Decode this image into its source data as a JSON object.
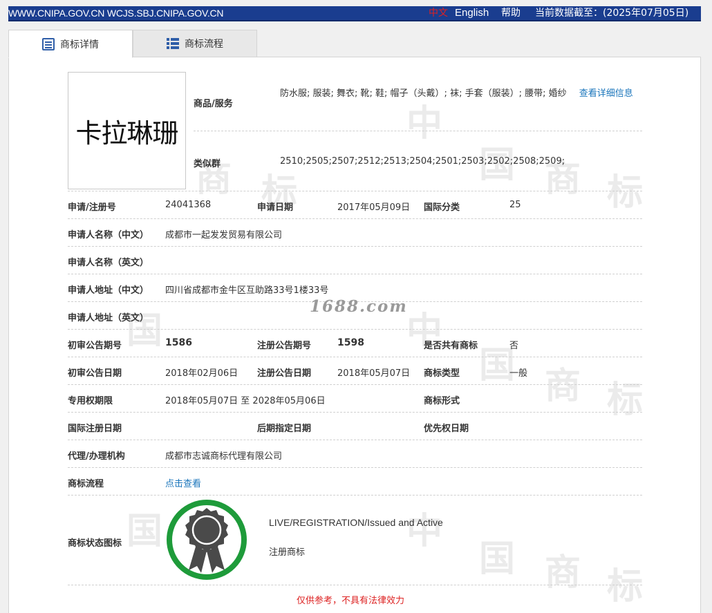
{
  "topbar": {
    "site": "WWW.CNIPA.GOV.CN WCJS.SBJ.CNIPA.GOV.CN",
    "lang_cn": "中文",
    "lang_en": "English",
    "help": "帮助",
    "as_of": "当前数据截至：(2025年07月05日)"
  },
  "tabs": [
    {
      "label": "商标详情",
      "icon": "detail-icon",
      "active": true
    },
    {
      "label": "商标流程",
      "icon": "list-icon",
      "active": false
    }
  ],
  "mark": {
    "image_text": "卡拉琳珊"
  },
  "goods": {
    "label": "商品/服务",
    "value": "防水服; 服装; 舞衣; 靴; 鞋; 帽子（头戴）; 袜; 手套（服装）; 腰带; 婚纱",
    "link": "查看详细信息"
  },
  "similar_group": {
    "label": "类似群",
    "value": "2510;2505;2507;2512;2513;2504;2501;2503;2502;2508;2509;"
  },
  "fields": {
    "reg_no_label": "申请/注册号",
    "reg_no": "24041368",
    "app_date_label": "申请日期",
    "app_date": "2017年05月09日",
    "intl_class_label": "国际分类",
    "intl_class": "25",
    "applicant_cn_label": "申请人名称（中文）",
    "applicant_cn": "成都市一起发发贸易有限公司",
    "applicant_en_label": "申请人名称（英文）",
    "address_cn_label": "申请人地址（中文）",
    "address_cn": "四川省成都市金牛区互助路33号1楼33号",
    "address_en_label": "申请人地址（英文）",
    "prelim_no_label": "初审公告期号",
    "prelim_no": "1586",
    "reg_pub_no_label": "注册公告期号",
    "reg_pub_no": "1598",
    "shared_label": "是否共有商标",
    "shared": "否",
    "prelim_date_label": "初审公告日期",
    "prelim_date": "2018年02月06日",
    "reg_pub_date_label": "注册公告日期",
    "reg_pub_date": "2018年05月07日",
    "mark_type_label": "商标类型",
    "mark_type": "一般",
    "term_label": "专用权期限",
    "term": "2018年05月07日 至 2028年05月06日",
    "mark_form_label": "商标形式",
    "intl_reg_date_label": "国际注册日期",
    "later_designation_label": "后期指定日期",
    "priority_date_label": "优先权日期",
    "agent_label": "代理/办理机构",
    "agent": "成都市志诚商标代理有限公司",
    "process_label": "商标流程",
    "process_link": "点击查看",
    "status_icon_label": "商标状态图标"
  },
  "status": {
    "en": "LIVE/REGISTRATION/Issued and Active",
    "cn": "注册商标",
    "ring_color": "#1e9b3a",
    "badge_color": "#4a4a4a"
  },
  "watermark_text": "1688.com",
  "disclaimer": "仅供参考，不具有法律效力"
}
